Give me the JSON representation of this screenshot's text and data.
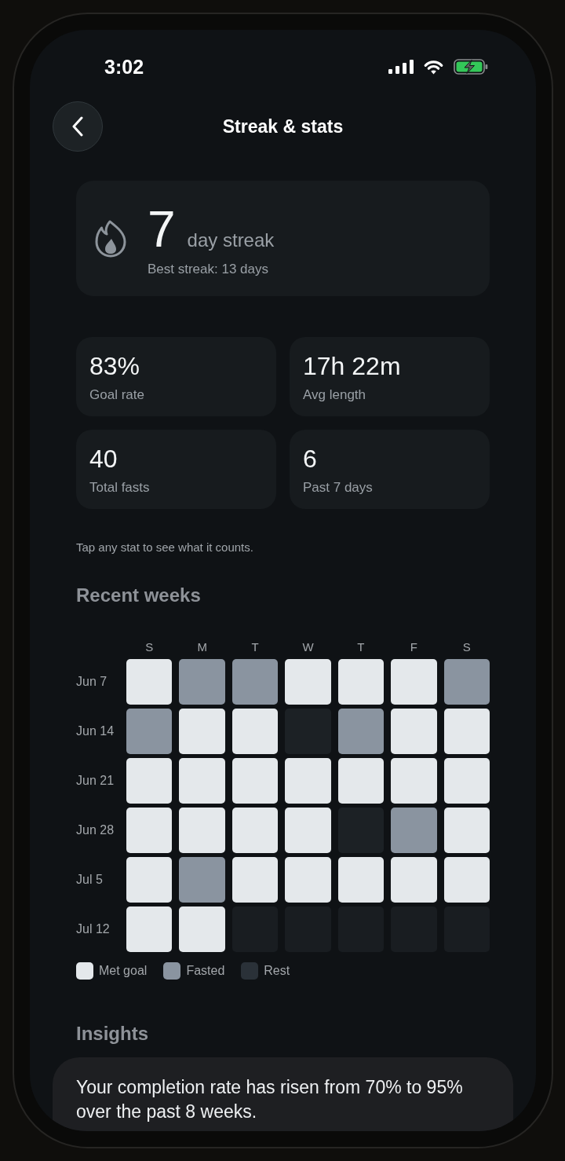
{
  "status_bar": {
    "time": "3:02"
  },
  "header": {
    "title": "Streak & stats"
  },
  "streak": {
    "count": "7",
    "unit": "day streak",
    "best": "Best streak: 13 days"
  },
  "stats": [
    {
      "value": "83%",
      "label": "Goal rate"
    },
    {
      "value": "17h 22m",
      "label": "Avg length"
    },
    {
      "value": "40",
      "label": "Total fasts"
    },
    {
      "value": "6",
      "label": "Past 7 days"
    }
  ],
  "stats_hint": "Tap any stat to see what it counts.",
  "calendar": {
    "title": "Recent weeks",
    "weekdays": [
      "S",
      "M",
      "T",
      "W",
      "T",
      "F",
      "S"
    ],
    "weeks": [
      {
        "label": "Jun 7",
        "days": [
          {
            "kind": "met"
          },
          {
            "kind": "fasted"
          },
          {
            "kind": "fasted"
          },
          {
            "kind": "met"
          },
          {
            "kind": "met"
          },
          {
            "kind": "met"
          },
          {
            "kind": "fasted"
          }
        ]
      },
      {
        "label": "Jun 14",
        "days": [
          {
            "kind": "fasted"
          },
          {
            "kind": "met"
          },
          {
            "kind": "met"
          },
          {
            "kind": "rest"
          },
          {
            "kind": "fasted"
          },
          {
            "kind": "met"
          },
          {
            "kind": "met"
          }
        ]
      },
      {
        "label": "Jun 21",
        "days": [
          {
            "kind": "met"
          },
          {
            "kind": "met"
          },
          {
            "kind": "met"
          },
          {
            "kind": "met"
          },
          {
            "kind": "met"
          },
          {
            "kind": "met"
          },
          {
            "kind": "met"
          }
        ]
      },
      {
        "label": "Jun 28",
        "days": [
          {
            "kind": "met"
          },
          {
            "kind": "met"
          },
          {
            "kind": "met"
          },
          {
            "kind": "met"
          },
          {
            "kind": "rest"
          },
          {
            "kind": "fasted"
          },
          {
            "kind": "met"
          }
        ]
      },
      {
        "label": "Jul 5",
        "days": [
          {
            "kind": "met"
          },
          {
            "kind": "fasted"
          },
          {
            "kind": "met"
          },
          {
            "kind": "met"
          },
          {
            "kind": "met"
          },
          {
            "kind": "met"
          },
          {
            "kind": "met"
          }
        ]
      },
      {
        "label": "Jul 12",
        "days": [
          {
            "kind": "met"
          },
          {
            "kind": "met"
          },
          {
            "kind": "empty"
          },
          {
            "kind": "empty"
          },
          {
            "kind": "empty"
          },
          {
            "kind": "empty"
          },
          {
            "kind": "empty"
          }
        ]
      }
    ]
  },
  "legend": [
    {
      "label": "Met goal",
      "kind": "met"
    },
    {
      "label": "Fasted",
      "kind": "fasted"
    },
    {
      "label": "Rest",
      "kind": "rest"
    }
  ],
  "insights": {
    "title": "Insights",
    "items": [
      {
        "text": "Your completion rate has risen from 70% to 95% over the past 8 weeks."
      }
    ]
  }
}
